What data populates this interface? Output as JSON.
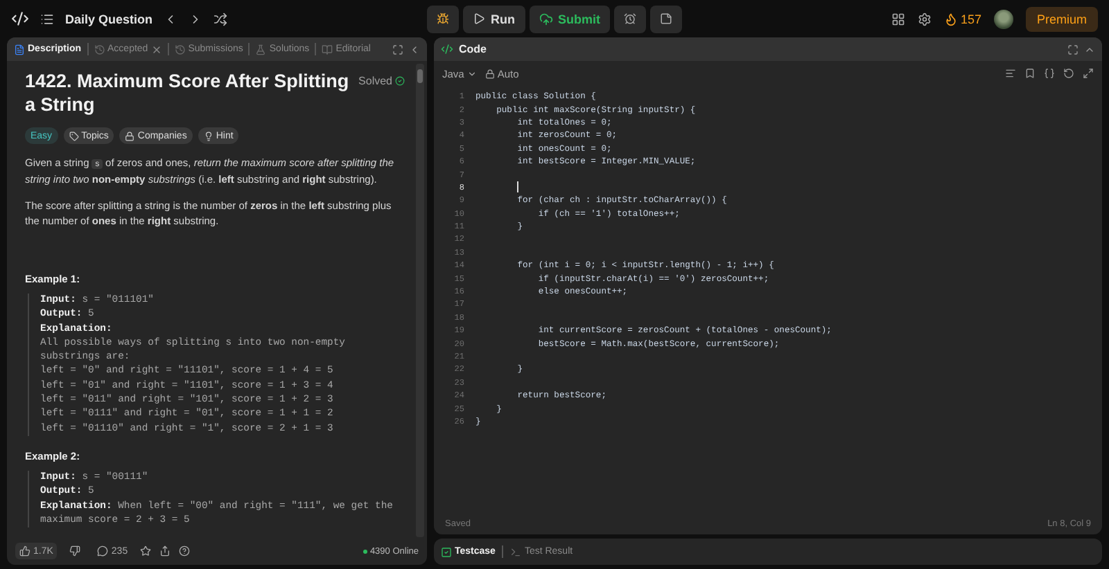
{
  "topbar": {
    "title": "Daily Question",
    "run": "Run",
    "submit": "Submit",
    "streak": "157",
    "premium": "Premium"
  },
  "description_panel": {
    "tabs": [
      {
        "label": "Description",
        "selected": true,
        "closable": false
      },
      {
        "label": "Accepted",
        "selected": false,
        "closable": true
      },
      {
        "label": "Submissions",
        "selected": false,
        "closable": false
      },
      {
        "label": "Solutions",
        "selected": false,
        "closable": false
      },
      {
        "label": "Editorial",
        "selected": false,
        "closable": false
      }
    ],
    "title": "1422. Maximum Score After Splitting a String",
    "status": "Solved",
    "tags": [
      {
        "label": "Easy",
        "kind": "difficulty"
      },
      {
        "label": "Topics",
        "kind": "topics"
      },
      {
        "label": "Companies",
        "kind": "companies"
      },
      {
        "label": "Hint",
        "kind": "hint"
      }
    ],
    "paragraphs": [
      [
        {
          "kind": "text",
          "text": "Given a string "
        },
        {
          "kind": "code",
          "text": "s"
        },
        {
          "kind": "text",
          "text": " of zeros and ones, *return the maximum score after splitting the string into two* **non-empty** *substrings* (i.e. **left** substring and **right** substring)."
        }
      ],
      [
        {
          "kind": "text",
          "text": "The score after splitting a string is the number of **zeros** in the **left** substring plus the number of **ones** in the **right** substring."
        }
      ]
    ],
    "examples": [
      {
        "heading": "Example 1:",
        "lines": [
          "**Input:** s = \"011101\"",
          "**Output:** 5",
          "**Explanation:**",
          "All possible ways of splitting s into two non-empty",
          "substrings are:",
          "left = \"0\" and right = \"11101\", score = 1 + 4 = 5",
          "left = \"01\" and right = \"1101\", score = 1 + 3 = 4",
          "left = \"011\" and right = \"101\", score = 1 + 2 = 3",
          "left = \"0111\" and right = \"01\", score = 1 + 1 = 2",
          "left = \"01110\" and right = \"1\", score = 2 + 1 = 3"
        ]
      },
      {
        "heading": "Example 2:",
        "lines": [
          "**Input:** s = \"00111\"",
          "**Output:** 5",
          "**Explanation:** When left = \"00\" and right = \"111\", we get the",
          "maximum score = 2 + 3 = 5"
        ]
      }
    ],
    "footer": {
      "likes": "1.7K",
      "comments": "235",
      "online": "4390 Online"
    }
  },
  "code_panel": {
    "title": "Code",
    "language": "Java",
    "mode": "Auto",
    "lines": [
      {
        "n": "1",
        "code": "public class Solution {",
        "active": false
      },
      {
        "n": "2",
        "code": "    public int maxScore(String inputStr) {",
        "active": false
      },
      {
        "n": "3",
        "code": "        int totalOnes = 0;",
        "active": false
      },
      {
        "n": "4",
        "code": "        int zerosCount = 0;",
        "active": false
      },
      {
        "n": "5",
        "code": "        int onesCount = 0;",
        "active": false
      },
      {
        "n": "6",
        "code": "        int bestScore = Integer.MIN_VALUE;",
        "active": false
      },
      {
        "n": "7",
        "active": false
      },
      {
        "n": "8",
        "active": true
      },
      {
        "n": "9",
        "code": "        for (char ch : inputStr.toCharArray()) {",
        "active": false
      },
      {
        "n": "10",
        "code": "            if (ch == '1') totalOnes++;",
        "active": false
      },
      {
        "n": "11",
        "code": "        }",
        "active": false
      },
      {
        "n": "12",
        "active": false
      },
      {
        "n": "13",
        "active": false
      },
      {
        "n": "14",
        "code": "        for (int i = 0; i < inputStr.length() - 1; i++) {",
        "active": false
      },
      {
        "n": "15",
        "code": "            if (inputStr.charAt(i) == '0') zerosCount++;",
        "active": false
      },
      {
        "n": "16",
        "code": "            else onesCount++;",
        "active": false
      },
      {
        "n": "17",
        "active": false
      },
      {
        "n": "18",
        "active": false
      },
      {
        "n": "19",
        "code": "            int currentScore = zerosCount + (totalOnes - onesCount);",
        "active": false
      },
      {
        "n": "20",
        "code": "            bestScore = Math.max(bestScore, currentScore);",
        "active": false
      },
      {
        "n": "21",
        "active": false
      },
      {
        "n": "22",
        "code": "        }",
        "active": false
      },
      {
        "n": "23",
        "active": false
      },
      {
        "n": "24",
        "code": "        return bestScore;",
        "active": false
      },
      {
        "n": "25",
        "code": "    }",
        "active": false
      },
      {
        "n": "26",
        "code": "}",
        "active": false
      }
    ],
    "saved": "Saved",
    "position": "Ln 8, Col 9"
  },
  "bottom_panel": {
    "tabs": [
      {
        "label": "Testcase",
        "selected": true
      },
      {
        "label": "Test Result",
        "selected": false
      }
    ]
  }
}
